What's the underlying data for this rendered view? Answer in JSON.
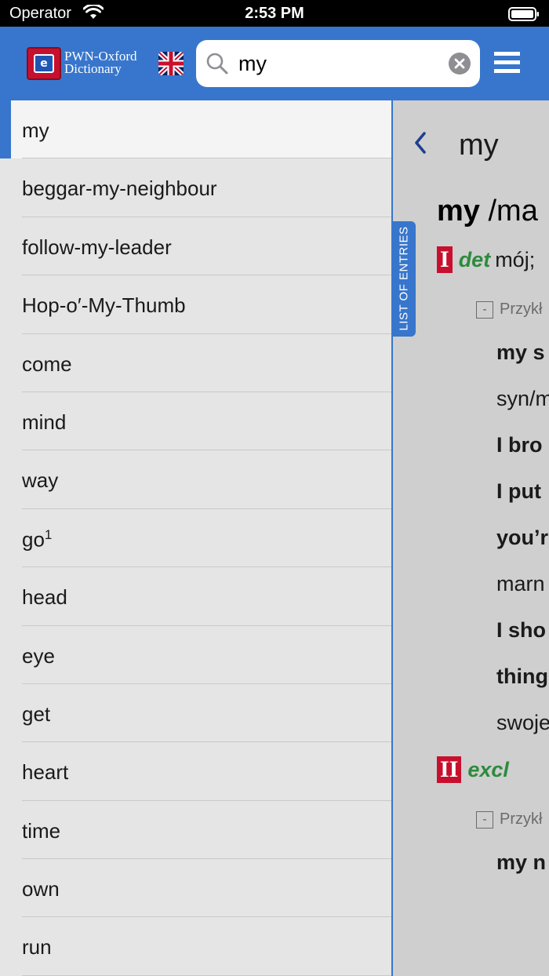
{
  "status_bar": {
    "carrier": "Operator",
    "time": "2:53 PM"
  },
  "header": {
    "logo_line1": "PWN-Oxford",
    "logo_line2": "Dictionary",
    "search_value": "my"
  },
  "entries": [
    {
      "label": "my"
    },
    {
      "label": "beggar-my-neighbour"
    },
    {
      "label": "follow-my-leader"
    },
    {
      "label": "Hop-o′-My-Thumb"
    },
    {
      "label": "come"
    },
    {
      "label": "mind"
    },
    {
      "label": "way"
    },
    {
      "label": "go",
      "sup": "1"
    },
    {
      "label": "head"
    },
    {
      "label": "eye"
    },
    {
      "label": "get"
    },
    {
      "label": "heart"
    },
    {
      "label": "time"
    },
    {
      "label": "own"
    },
    {
      "label": "run"
    }
  ],
  "list_tab_label": "LIST OF ENTRIES",
  "definition": {
    "title": "my",
    "headword": "my",
    "pronunciation": "/ma",
    "sense1": {
      "roman": "I",
      "pos": "det",
      "gloss": "mój;"
    },
    "examples_label": "Przykł",
    "examples1": [
      "my s",
      "syn/m",
      "I bro",
      "I put",
      "you’r",
      "marn",
      "I sho",
      "thing",
      "swoje"
    ],
    "sense2": {
      "roman": "II",
      "pos": "excl"
    },
    "examples2": [
      "my n"
    ]
  }
}
